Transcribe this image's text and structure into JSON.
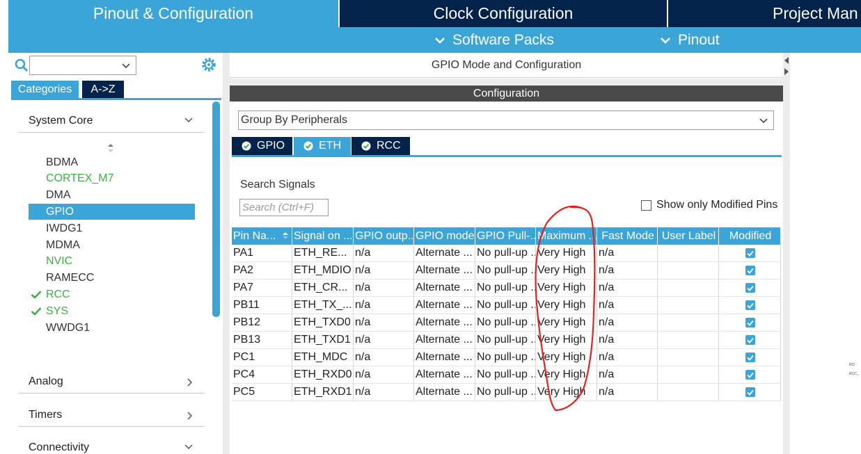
{
  "top_tabs": [
    {
      "id": "pinout",
      "label": "Pinout & Configuration"
    },
    {
      "id": "clock",
      "label": "Clock Configuration"
    },
    {
      "id": "project",
      "label": "Project Man"
    }
  ],
  "sub_nav": {
    "software_packs": "Software Packs",
    "pinout": "Pinout"
  },
  "left_panel": {
    "tabs": {
      "categories": "Categories",
      "az": "A->Z"
    },
    "categories": {
      "system_core": "System Core",
      "analog": "Analog",
      "timers": "Timers",
      "connectivity": "Connectivity"
    },
    "system_core_items": [
      {
        "label": "BDMA",
        "state": "normal"
      },
      {
        "label": "CORTEX_M7",
        "state": "green"
      },
      {
        "label": "DMA",
        "state": "normal"
      },
      {
        "label": "GPIO",
        "state": "selected"
      },
      {
        "label": "IWDG1",
        "state": "normal"
      },
      {
        "label": "MDMA",
        "state": "normal"
      },
      {
        "label": "NVIC",
        "state": "green"
      },
      {
        "label": "RAMECC",
        "state": "normal"
      },
      {
        "label": "RCC",
        "state": "checked"
      },
      {
        "label": "SYS",
        "state": "checked"
      },
      {
        "label": "WWDG1",
        "state": "normal"
      }
    ]
  },
  "right_panel": {
    "title": "GPIO Mode and Configuration",
    "config_header": "Configuration",
    "group_select": "Group By Peripherals",
    "peripheral_tabs": {
      "gpio": "GPIO",
      "eth": "ETH",
      "rcc": "RCC"
    },
    "search_label": "Search Signals",
    "search_placeholder": "Search (Ctrl+F)",
    "show_modified": "Show only Modified Pins"
  },
  "table": {
    "columns": [
      "Pin Na...",
      "Signal on ...",
      "GPIO outp...",
      "GPIO mode",
      "GPIO Pull-...",
      "Maximum ...",
      "Fast Mode",
      "User Label",
      "Modified"
    ],
    "rows": [
      [
        "PA1",
        "ETH_RE...",
        "n/a",
        "Alternate ...",
        "No pull-up ...",
        "Very High",
        "n/a",
        "",
        true
      ],
      [
        "PA2",
        "ETH_MDIO",
        "n/a",
        "Alternate ...",
        "No pull-up ...",
        "Very High",
        "n/a",
        "",
        true
      ],
      [
        "PA7",
        "ETH_CR...",
        "n/a",
        "Alternate ...",
        "No pull-up ...",
        "Very High",
        "n/a",
        "",
        true
      ],
      [
        "PB11",
        "ETH_TX_...",
        "n/a",
        "Alternate ...",
        "No pull-up ...",
        "Very High",
        "n/a",
        "",
        true
      ],
      [
        "PB12",
        "ETH_TXD0",
        "n/a",
        "Alternate ...",
        "No pull-up ...",
        "Very High",
        "n/a",
        "",
        true
      ],
      [
        "PB13",
        "ETH_TXD1",
        "n/a",
        "Alternate ...",
        "No pull-up ...",
        "Very High",
        "n/a",
        "",
        true
      ],
      [
        "PC1",
        "ETH_MDC",
        "n/a",
        "Alternate ...",
        "No pull-up ...",
        "Very High",
        "n/a",
        "",
        true
      ],
      [
        "PC4",
        "ETH_RXD0",
        "n/a",
        "Alternate ...",
        "No pull-up ...",
        "Very High",
        "n/a",
        "",
        true
      ],
      [
        "PC5",
        "ETH_RXD1",
        "n/a",
        "Alternate ...",
        "No pull-up ...",
        "Very High",
        "n/a",
        "",
        true
      ]
    ]
  },
  "edge_labels": [
    "RCl",
    "RCC_"
  ],
  "colors": {
    "accent": "#3ca5d8",
    "dark_navy": "#03234b",
    "active_green": "#3cb043",
    "annotation_red": "#e8201c"
  }
}
